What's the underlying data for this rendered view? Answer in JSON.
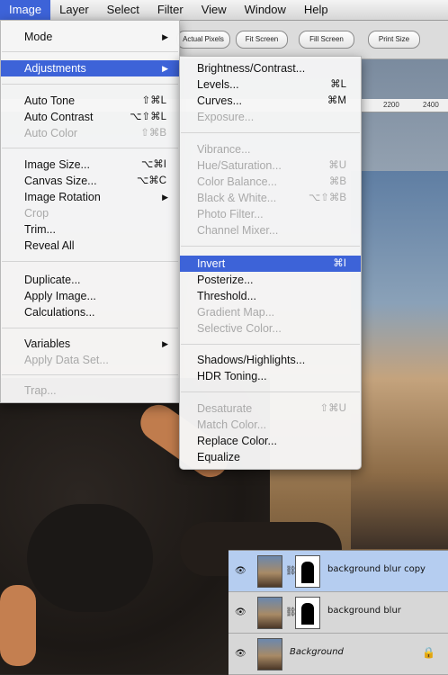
{
  "menubar": {
    "items": [
      "Image",
      "Layer",
      "Select",
      "Filter",
      "View",
      "Window",
      "Help"
    ]
  },
  "options_bar": {
    "buttons": [
      "Actual Pixels",
      "Fit Screen",
      "Fill Screen",
      "Print Size"
    ]
  },
  "ruler": {
    "labels": [
      "2200",
      "2400"
    ]
  },
  "image_menu": {
    "items": [
      {
        "label": "Mode",
        "shortcut": "",
        "submenu": true,
        "disabled": false
      },
      {
        "label": "Adjustments",
        "shortcut": "",
        "submenu": true,
        "disabled": false,
        "selected": true
      },
      {
        "label": "Auto Tone",
        "shortcut": "⇧⌘L",
        "disabled": false
      },
      {
        "label": "Auto Contrast",
        "shortcut": "⌥⇧⌘L",
        "disabled": false
      },
      {
        "label": "Auto Color",
        "shortcut": "⇧⌘B",
        "disabled": true
      },
      {
        "label": "Image Size...",
        "shortcut": "⌥⌘I",
        "disabled": false
      },
      {
        "label": "Canvas Size...",
        "shortcut": "⌥⌘C",
        "disabled": false
      },
      {
        "label": "Image Rotation",
        "shortcut": "",
        "submenu": true,
        "disabled": false
      },
      {
        "label": "Crop",
        "shortcut": "",
        "disabled": true
      },
      {
        "label": "Trim...",
        "shortcut": "",
        "disabled": false
      },
      {
        "label": "Reveal All",
        "shortcut": "",
        "disabled": false
      },
      {
        "label": "Duplicate...",
        "shortcut": "",
        "disabled": false
      },
      {
        "label": "Apply Image...",
        "shortcut": "",
        "disabled": false
      },
      {
        "label": "Calculations...",
        "shortcut": "",
        "disabled": false
      },
      {
        "label": "Variables",
        "shortcut": "",
        "submenu": true,
        "disabled": false
      },
      {
        "label": "Apply Data Set...",
        "shortcut": "",
        "disabled": true
      },
      {
        "label": "Trap...",
        "shortcut": "",
        "disabled": true
      }
    ]
  },
  "adjustments_menu": {
    "items": [
      {
        "label": "Brightness/Contrast...",
        "shortcut": "",
        "disabled": false
      },
      {
        "label": "Levels...",
        "shortcut": "⌘L",
        "disabled": false
      },
      {
        "label": "Curves...",
        "shortcut": "⌘M",
        "disabled": false
      },
      {
        "label": "Exposure...",
        "shortcut": "",
        "disabled": true
      },
      {
        "label": "Vibrance...",
        "shortcut": "",
        "disabled": true
      },
      {
        "label": "Hue/Saturation...",
        "shortcut": "⌘U",
        "disabled": true
      },
      {
        "label": "Color Balance...",
        "shortcut": "⌘B",
        "disabled": true
      },
      {
        "label": "Black & White...",
        "shortcut": "⌥⇧⌘B",
        "disabled": true
      },
      {
        "label": "Photo Filter...",
        "shortcut": "",
        "disabled": true
      },
      {
        "label": "Channel Mixer...",
        "shortcut": "",
        "disabled": true
      },
      {
        "label": "Invert",
        "shortcut": "⌘I",
        "disabled": false,
        "selected": true
      },
      {
        "label": "Posterize...",
        "shortcut": "",
        "disabled": false
      },
      {
        "label": "Threshold...",
        "shortcut": "",
        "disabled": false
      },
      {
        "label": "Gradient Map...",
        "shortcut": "",
        "disabled": true
      },
      {
        "label": "Selective Color...",
        "shortcut": "",
        "disabled": true
      },
      {
        "label": "Shadows/Highlights...",
        "shortcut": "",
        "disabled": false
      },
      {
        "label": "HDR Toning...",
        "shortcut": "",
        "disabled": false
      },
      {
        "label": "Desaturate",
        "shortcut": "⇧⌘U",
        "disabled": true
      },
      {
        "label": "Match Color...",
        "shortcut": "",
        "disabled": true
      },
      {
        "label": "Replace Color...",
        "shortcut": "",
        "disabled": false
      },
      {
        "label": "Equalize",
        "shortcut": "",
        "disabled": false
      }
    ]
  },
  "layers_panel": {
    "layers": [
      {
        "name": "background blur copy",
        "selected": true,
        "has_mask": true,
        "italic": false
      },
      {
        "name": "background blur",
        "selected": false,
        "has_mask": true,
        "italic": false
      },
      {
        "name": "Background",
        "selected": false,
        "has_mask": false,
        "italic": true,
        "locked": true
      }
    ]
  },
  "colors": {
    "selection": "#3d63d8",
    "layer_selected": "#b5cdf0"
  }
}
